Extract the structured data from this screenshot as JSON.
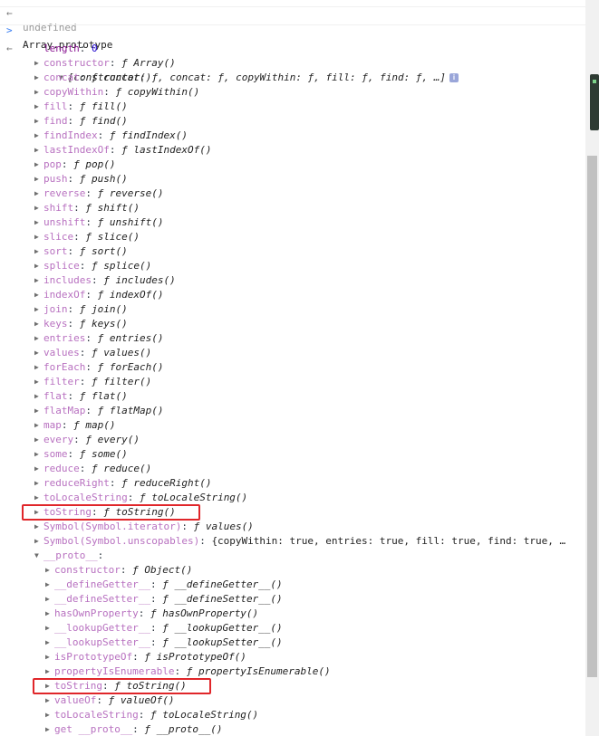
{
  "console": {
    "top_cut_text": "undefined",
    "input_text": "Array.prototype",
    "summary": {
      "open": "[constructor: ",
      "parts": [
        {
          "key": "constructor",
          "val": "ƒ"
        },
        {
          "key": "concat",
          "val": "ƒ"
        },
        {
          "key": "copyWithin",
          "val": "ƒ"
        },
        {
          "key": "fill",
          "val": "ƒ"
        },
        {
          "key": "find",
          "val": "ƒ"
        }
      ],
      "text": "[constructor: ƒ, concat: ƒ, copyWithin: ƒ, fill: ƒ, find: ƒ, …]",
      "info_badge": "i"
    },
    "length": {
      "key": "length",
      "value": "0"
    },
    "props": [
      {
        "key": "constructor",
        "fn": "Array()"
      },
      {
        "key": "concat",
        "fn": "concat()"
      },
      {
        "key": "copyWithin",
        "fn": "copyWithin()"
      },
      {
        "key": "fill",
        "fn": "fill()"
      },
      {
        "key": "find",
        "fn": "find()"
      },
      {
        "key": "findIndex",
        "fn": "findIndex()"
      },
      {
        "key": "lastIndexOf",
        "fn": "lastIndexOf()"
      },
      {
        "key": "pop",
        "fn": "pop()"
      },
      {
        "key": "push",
        "fn": "push()"
      },
      {
        "key": "reverse",
        "fn": "reverse()"
      },
      {
        "key": "shift",
        "fn": "shift()"
      },
      {
        "key": "unshift",
        "fn": "unshift()"
      },
      {
        "key": "slice",
        "fn": "slice()"
      },
      {
        "key": "sort",
        "fn": "sort()"
      },
      {
        "key": "splice",
        "fn": "splice()"
      },
      {
        "key": "includes",
        "fn": "includes()"
      },
      {
        "key": "indexOf",
        "fn": "indexOf()"
      },
      {
        "key": "join",
        "fn": "join()"
      },
      {
        "key": "keys",
        "fn": "keys()"
      },
      {
        "key": "entries",
        "fn": "entries()"
      },
      {
        "key": "values",
        "fn": "values()"
      },
      {
        "key": "forEach",
        "fn": "forEach()"
      },
      {
        "key": "filter",
        "fn": "filter()"
      },
      {
        "key": "flat",
        "fn": "flat()"
      },
      {
        "key": "flatMap",
        "fn": "flatMap()"
      },
      {
        "key": "map",
        "fn": "map()"
      },
      {
        "key": "every",
        "fn": "every()"
      },
      {
        "key": "some",
        "fn": "some()"
      },
      {
        "key": "reduce",
        "fn": "reduce()"
      },
      {
        "key": "reduceRight",
        "fn": "reduceRight()"
      },
      {
        "key": "toLocaleString",
        "fn": "toLocaleString()"
      },
      {
        "key": "toString",
        "fn": "toString()",
        "highlight": true
      },
      {
        "key": "Symbol(Symbol.iterator)",
        "fn": "values()"
      }
    ],
    "unscopables": {
      "key": "Symbol(Symbol.unscopables)",
      "value": "{copyWithin: true, entries: true, fill: true, find: true, …"
    },
    "proto": {
      "key": "__proto__",
      "props": [
        {
          "key": "constructor",
          "fn": "Object()"
        },
        {
          "key": "__defineGetter__",
          "fn": "__defineGetter__()"
        },
        {
          "key": "__defineSetter__",
          "fn": "__defineSetter__()"
        },
        {
          "key": "hasOwnProperty",
          "fn": "hasOwnProperty()"
        },
        {
          "key": "__lookupGetter__",
          "fn": "__lookupGetter__()"
        },
        {
          "key": "__lookupSetter__",
          "fn": "__lookupSetter__()"
        },
        {
          "key": "isPrototypeOf",
          "fn": "isPrototypeOf()"
        },
        {
          "key": "propertyIsEnumerable",
          "fn": "propertyIsEnumerable()"
        },
        {
          "key": "toString",
          "fn": "toString()",
          "highlight": true
        },
        {
          "key": "valueOf",
          "fn": "valueOf()"
        },
        {
          "key": "toLocaleString",
          "fn": "toLocaleString()"
        },
        {
          "key": "get __proto__",
          "fn": "__proto__()"
        }
      ]
    },
    "fsym": "ƒ",
    "colors": {
      "key": "#881391",
      "number": "#1c00cf",
      "highlight": "#e0262a"
    }
  }
}
